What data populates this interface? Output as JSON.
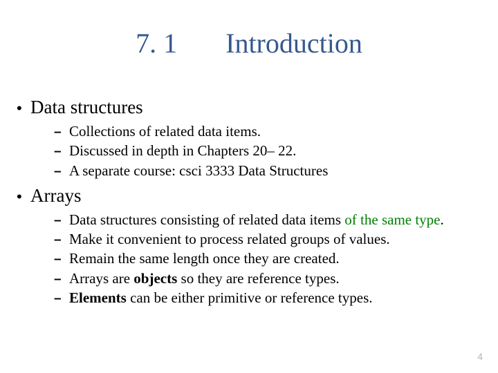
{
  "title": {
    "number": "7. 1",
    "text": "Introduction"
  },
  "sections": [
    {
      "heading": "Data structures",
      "items": [
        {
          "runs": [
            {
              "t": "Collections of related data items."
            }
          ]
        },
        {
          "runs": [
            {
              "t": "Discussed in depth in Chapters 20– 22."
            }
          ]
        },
        {
          "runs": [
            {
              "t": "A separate course: csci 3333 Data Structures"
            }
          ]
        }
      ]
    },
    {
      "heading": "Arrays",
      "items": [
        {
          "runs": [
            {
              "t": "Data structures consisting of related data items "
            },
            {
              "t": "of the same type",
              "cls": "green"
            },
            {
              "t": "."
            }
          ]
        },
        {
          "runs": [
            {
              "t": "Make it convenient to process related groups of values."
            }
          ]
        },
        {
          "runs": [
            {
              "t": "Remain the same length once they are created."
            }
          ]
        },
        {
          "runs": [
            {
              "t": "Arrays are "
            },
            {
              "t": "objects ",
              "cls": "bold"
            },
            {
              "t": "so they are reference types."
            }
          ]
        },
        {
          "runs": [
            {
              "t": "Elements",
              "cls": "bold"
            },
            {
              "t": " can be either primitive or reference types."
            }
          ]
        }
      ]
    }
  ],
  "page_number": "4"
}
